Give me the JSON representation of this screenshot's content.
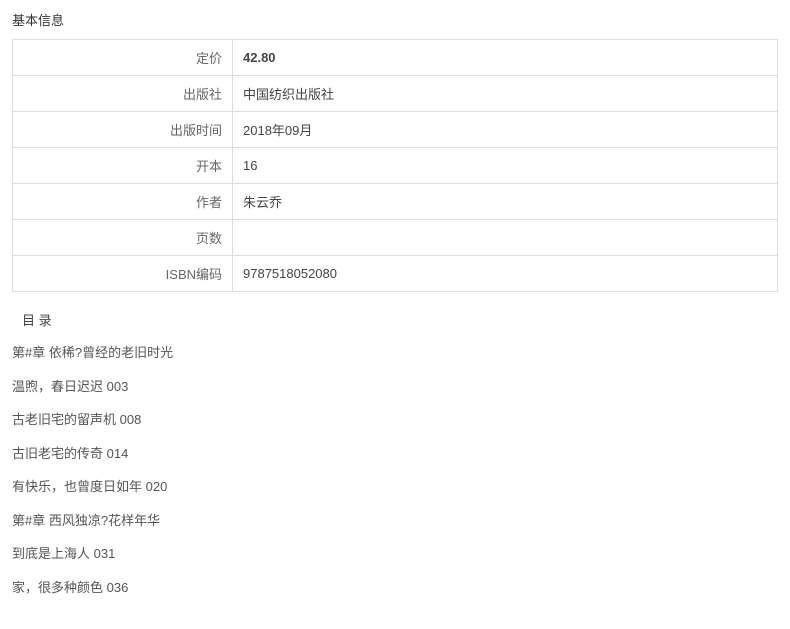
{
  "section_title": "基本信息",
  "info": {
    "rows": [
      {
        "label": "定价",
        "value": "42.80",
        "is_price": true
      },
      {
        "label": "出版社",
        "value": "中国纺织出版社",
        "is_price": false
      },
      {
        "label": "出版时间",
        "value": "2018年09月",
        "is_price": false
      },
      {
        "label": "开本",
        "value": "16",
        "is_price": false
      },
      {
        "label": "作者",
        "value": "朱云乔",
        "is_price": false
      },
      {
        "label": "页数",
        "value": "",
        "is_price": false
      },
      {
        "label": "ISBN编码",
        "value": "9787518052080",
        "is_price": false
      }
    ]
  },
  "toc": {
    "title": "目 录",
    "lines": [
      "第#章 依稀?曾经的老旧时光",
      "温煦，春日迟迟  003",
      "古老旧宅的留声机  008",
      "古旧老宅的传奇  014",
      "有快乐，也曾度日如年  020",
      "第#章 西风独凉?花样年华",
      "到底是上海人  031",
      "家，很多种颜色  036"
    ]
  }
}
